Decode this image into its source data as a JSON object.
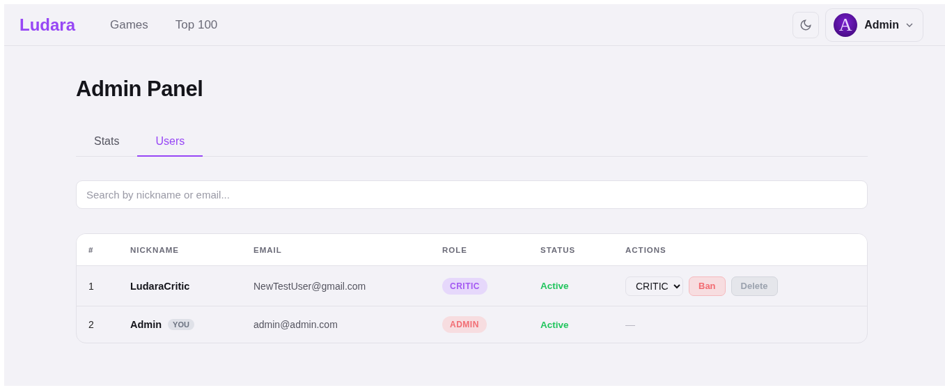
{
  "header": {
    "logo": "Ludara",
    "nav": [
      {
        "label": "Games"
      },
      {
        "label": "Top 100"
      }
    ],
    "user": {
      "avatar_letter": "A",
      "name": "Admin"
    }
  },
  "page": {
    "title": "Admin Panel",
    "tabs": [
      {
        "label": "Stats",
        "selected": false
      },
      {
        "label": "Users",
        "selected": true
      }
    ],
    "search": {
      "placeholder": "Search by nickname or email..."
    },
    "table": {
      "columns": [
        "#",
        "NICKNAME",
        "EMAIL",
        "ROLE",
        "STATUS",
        "ACTIONS"
      ],
      "rows": [
        {
          "index": "1",
          "nickname": "LudaraCritic",
          "email": "NewTestUser@gmail.com",
          "role": {
            "label": "CRITIC",
            "kind": "critic"
          },
          "status": {
            "label": "Active",
            "kind": "active"
          },
          "actions": {
            "kind": "controls",
            "role_select": "CRITIC",
            "ban": "Ban",
            "delete": "Delete"
          }
        },
        {
          "index": "2",
          "nickname": "Admin",
          "you_badge": "YOU",
          "email": "admin@admin.com",
          "role": {
            "label": "ADMIN",
            "kind": "admin"
          },
          "status": {
            "label": "Active",
            "kind": "active"
          },
          "actions": {
            "kind": "none",
            "text": "—"
          }
        }
      ]
    }
  }
}
